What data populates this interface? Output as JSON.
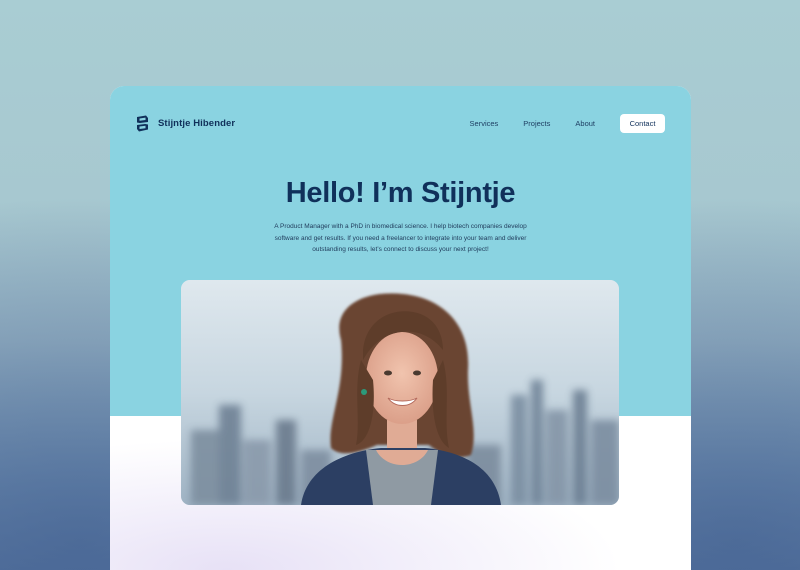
{
  "brand": {
    "name": "Stijntje Hibender",
    "logo_icon": "brand-s-logo-icon"
  },
  "nav": {
    "links": [
      {
        "label": "Services"
      },
      {
        "label": "Projects"
      },
      {
        "label": "About"
      }
    ],
    "contact_label": "Contact"
  },
  "hero": {
    "title": "Hello! I’m Stijntje",
    "description": "A Product Manager with a PhD in biomedical science. I help biotech companies develop software and get results. If you need a freelancer to integrate into your team and deliver outstanding results, let’s connect to discuss your next project!"
  },
  "colors": {
    "primary": "#10305a",
    "hero_bg": "#8ad3e1",
    "button_bg": "#ffffff"
  }
}
